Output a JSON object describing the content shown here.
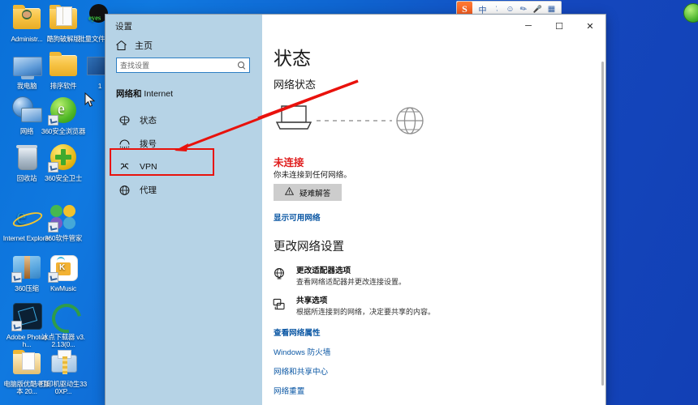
{
  "desktop": {
    "icons": [
      {
        "label": "Administr...",
        "type": "folder-user"
      },
      {
        "label": "酷狗破解版",
        "type": "folder-doc"
      },
      {
        "label": "批量文件修改",
        "type": "eyes-app"
      },
      {
        "label": "我电脑",
        "type": "computer"
      },
      {
        "label": "排序软件",
        "type": "folder"
      },
      {
        "label": "1",
        "type": "picture"
      },
      {
        "label": "网络",
        "type": "network"
      },
      {
        "label": "360安全浏览器",
        "type": "browser-360"
      },
      {
        "label": "回收站",
        "type": "recycle-bin"
      },
      {
        "label": "360安全卫士",
        "type": "guard-360"
      },
      {
        "label": "Internet Explorer",
        "type": "ie"
      },
      {
        "label": "360软件管家",
        "type": "soft-mgr-360"
      },
      {
        "label": "360压缩",
        "type": "zip-360"
      },
      {
        "label": "KwMusic",
        "type": "kwmusic"
      },
      {
        "label": "Adobe Photosh...",
        "type": "photoshop"
      },
      {
        "label": "冰点下载器 v3.2.13(0...",
        "type": "bingdian"
      },
      {
        "label": "电脑版优酷老版本 20...",
        "type": "folder"
      },
      {
        "label": "打印机驱动生330XP...",
        "type": "printer-zip"
      }
    ]
  },
  "ime": {
    "logo": "S",
    "items": [
      "中",
      "，。",
      "☺",
      "✎",
      "🎤",
      "▦"
    ],
    "names": [
      "chinese-mode",
      "punctuation-mode",
      "emoji",
      "handwriting",
      "voice-input",
      "toolbox"
    ]
  },
  "window": {
    "title": "设置",
    "caption": {
      "minimize": "─",
      "maximize": "☐",
      "close": "✕"
    }
  },
  "sidebar": {
    "home_label": "主页",
    "search_placeholder": "查找设置",
    "category": "网络和",
    "category_suffix": " Internet",
    "items": [
      {
        "label": "状态",
        "icon": "status-icon"
      },
      {
        "label": "拨号",
        "icon": "dialup-icon"
      },
      {
        "label": "VPN",
        "icon": "vpn-icon"
      },
      {
        "label": "代理",
        "icon": "proxy-icon"
      }
    ],
    "highlighted_item": "拨号"
  },
  "content": {
    "title": "状态",
    "subtitle": "网络状态",
    "status_text": "未连接",
    "status_detail": "你未连接到任何网络。",
    "troubleshoot_button": "疑难解答",
    "show_networks_link": "显示可用网络",
    "change_settings_heading": "更改网络设置",
    "options": [
      {
        "title": "更改适配器选项",
        "desc": "查看网络适配器并更改连接设置。",
        "icon": "adapter-icon"
      },
      {
        "title": "共享选项",
        "desc": "根据所连接到的网络，决定要共享的内容。",
        "icon": "sharing-icon"
      }
    ],
    "links": [
      {
        "label": "查看网络属性",
        "bold": true
      },
      {
        "label": "Windows 防火墙",
        "bold": false
      },
      {
        "label": "网络和共享中心",
        "bold": false
      },
      {
        "label": "网络重置",
        "bold": false
      }
    ]
  },
  "annotations": {
    "arrow_color": "#e8120c",
    "highlight_color": "#e8120c",
    "strike_color": "#ee1111"
  }
}
